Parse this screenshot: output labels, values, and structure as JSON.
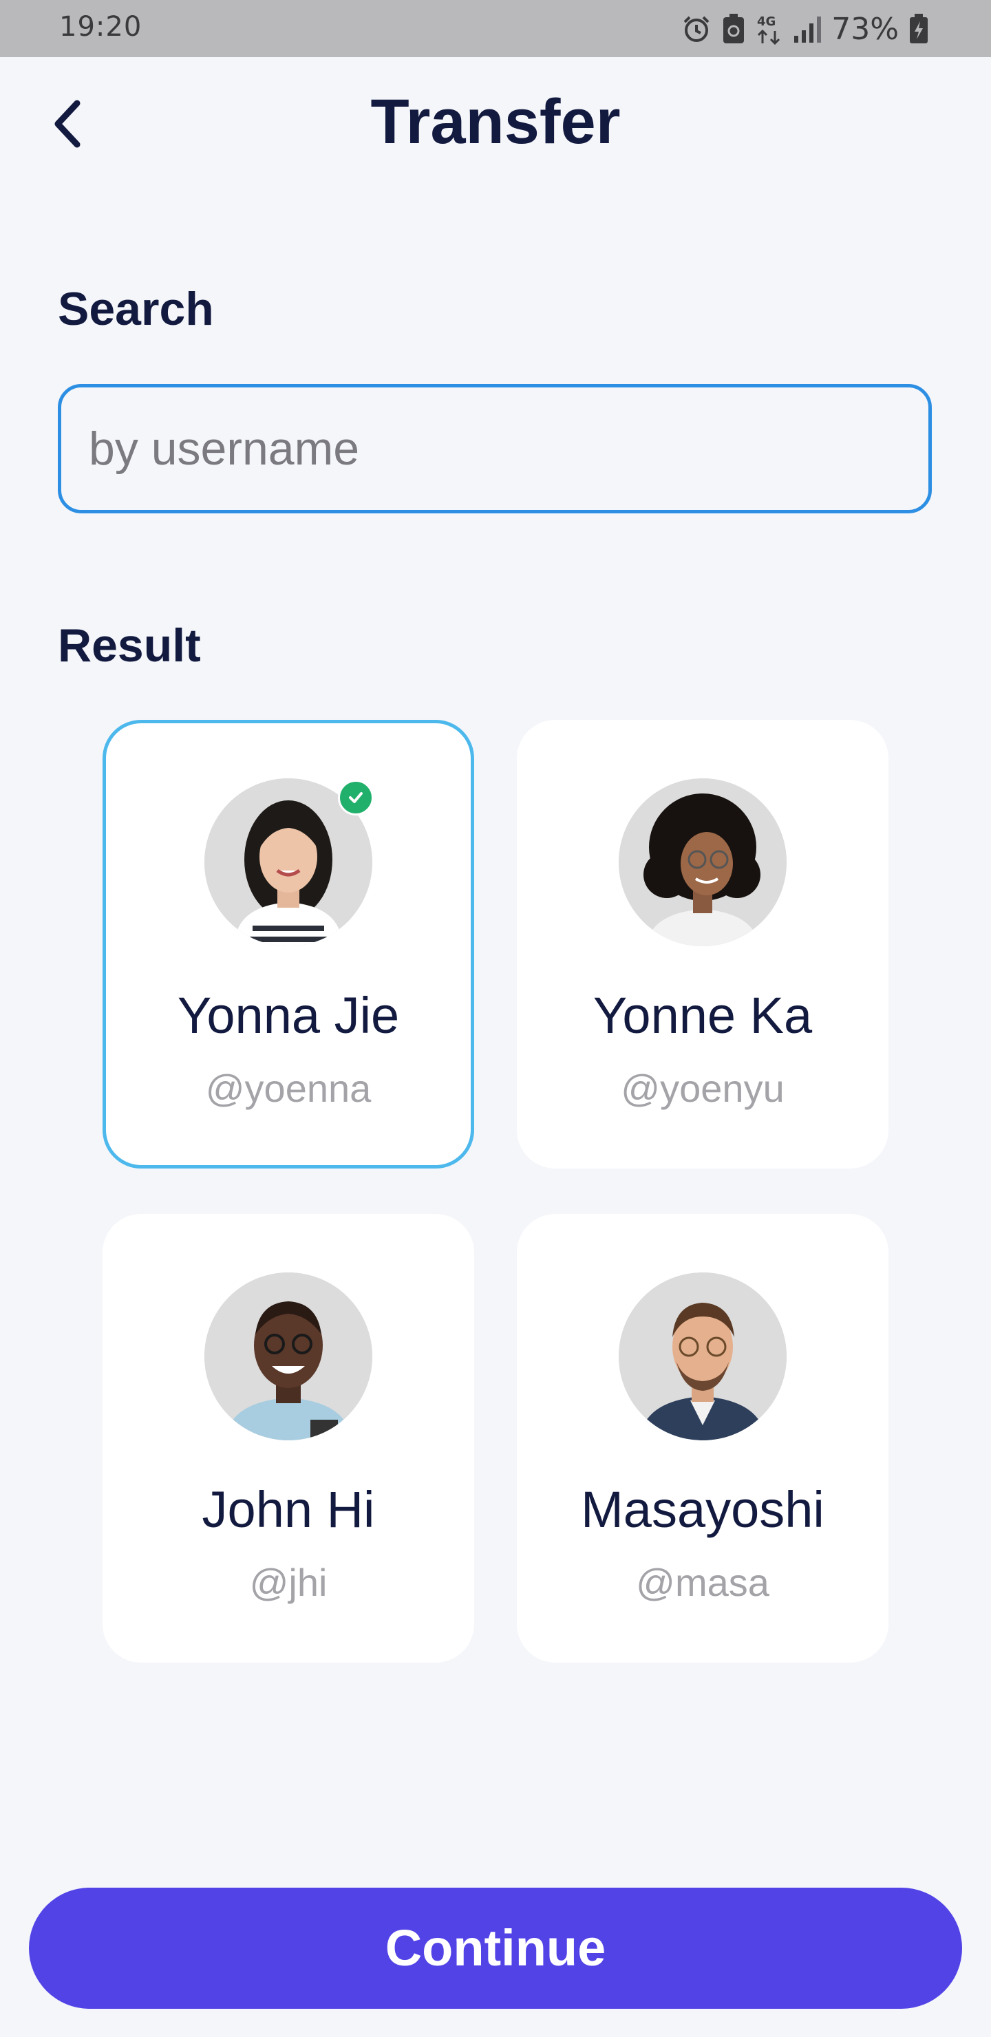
{
  "status_bar": {
    "time": "19:20",
    "battery": "73%",
    "network": "4G",
    "icons": [
      "alarm-icon",
      "battery-saver-icon",
      "network-4g-icon",
      "signal-icon",
      "battery-charging-icon"
    ]
  },
  "header": {
    "back_icon": "chevron-left-icon",
    "title": "Transfer"
  },
  "search": {
    "label": "Search",
    "value": "",
    "placeholder": "by username"
  },
  "results": {
    "label": "Result",
    "users": [
      {
        "name": "Yonna Jie",
        "handle": "@yoenna",
        "selected": true
      },
      {
        "name": "Yonne Ka",
        "handle": "@yoenyu",
        "selected": false
      },
      {
        "name": "John Hi",
        "handle": "@jhi",
        "selected": false
      },
      {
        "name": "Masayoshi",
        "handle": "@masa",
        "selected": false
      }
    ]
  },
  "footer": {
    "continue_label": "Continue"
  },
  "colors": {
    "primary": "#5243e6",
    "selected_border": "#4db8ec",
    "input_border": "#2d8fe3",
    "check_badge": "#21b06b",
    "title_text": "#131a3f",
    "handle_text": "#a3a3a8",
    "background": "#f5f6fa"
  }
}
